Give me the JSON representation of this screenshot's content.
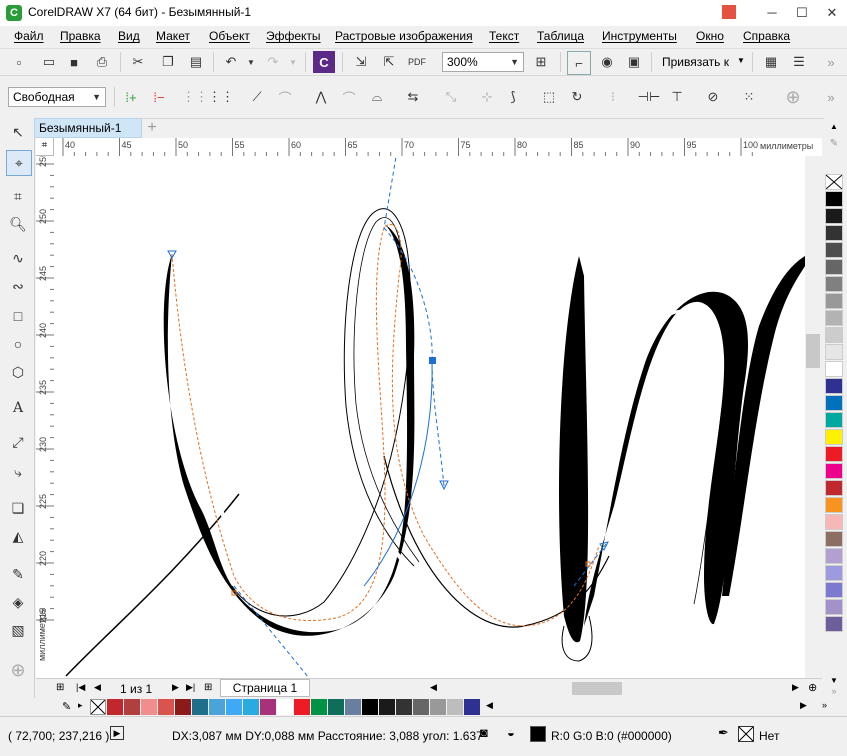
{
  "window": {
    "title": "CorelDRAW X7 (64 бит) - Безымянный-1",
    "app_icon": "coreldraw-icon",
    "controls": [
      "─",
      "☐",
      "✕"
    ]
  },
  "menu": [
    "Файл",
    "Правка",
    "Вид",
    "Макет",
    "Объект",
    "Эффекты",
    "Растровые изображения",
    "Текст",
    "Таблица",
    "Инструменты",
    "Окно",
    "Справка"
  ],
  "standard_toolbar": {
    "zoom_value": "300%",
    "snap_label": "Привязать к"
  },
  "property_bar": {
    "mode_value": "Свободная"
  },
  "document": {
    "tab_label": "Безымянный-1",
    "add_tab": "+"
  },
  "rulers": {
    "h_ticks": [
      "40",
      "45",
      "50",
      "55",
      "60",
      "65",
      "70",
      "75",
      "80",
      "85",
      "90",
      "95",
      "100"
    ],
    "h_unit": "миллиметры",
    "v_ticks": [
      "255",
      "250",
      "245",
      "240",
      "235",
      "230",
      "225",
      "220",
      "215"
    ],
    "v_unit": "миллиметры"
  },
  "page_nav": {
    "counter": "1 из 1",
    "page_tab": "Страница 1"
  },
  "palette_colors": [
    "#000000",
    "#1a1a1a",
    "#333333",
    "#4d4d4d",
    "#666666",
    "#808080",
    "#999999",
    "#b3b3b3",
    "#cccccc",
    "#e6e6e6",
    "#ffffff",
    "#2e3192",
    "#0071bc",
    "#00a99d",
    "#fff200",
    "#ed1c24",
    "#ec008c",
    "#c1272d",
    "#f7931e",
    "#f9b6b6",
    "#8c6e63",
    "#b3a0d1",
    "#9e9ae0",
    "#7d78d0",
    "#a391c9",
    "#6b5e9b"
  ],
  "doc_palette_colors": [
    "#c1272d",
    "#b04040",
    "#f18d8d",
    "#d9534f",
    "#8b1a1a",
    "#1f6f8b",
    "#4aa3d9",
    "#3fa9f5",
    "#29abe2",
    "#a83279",
    "#ffffff",
    "#ed1c24",
    "#009245",
    "#0e6e5a",
    "#6a7fa0",
    "#000000",
    "#1a1a1a",
    "#333333",
    "#666666",
    "#999999",
    "#bdbdbd",
    "#2e3192"
  ],
  "status": {
    "coords": "( 72,700; 237,216 )",
    "delta": "DX:3,087 мм DY:0,088 мм Расстояние: 3,088 угол: 1.637",
    "fill": "R:0 G:0 B:0 (#000000)",
    "outline": "Нет"
  },
  "colors": {
    "accent_blue": "#1c6fd6",
    "node_orange": "#e07020",
    "tab_bg": "#cfe6f7"
  }
}
